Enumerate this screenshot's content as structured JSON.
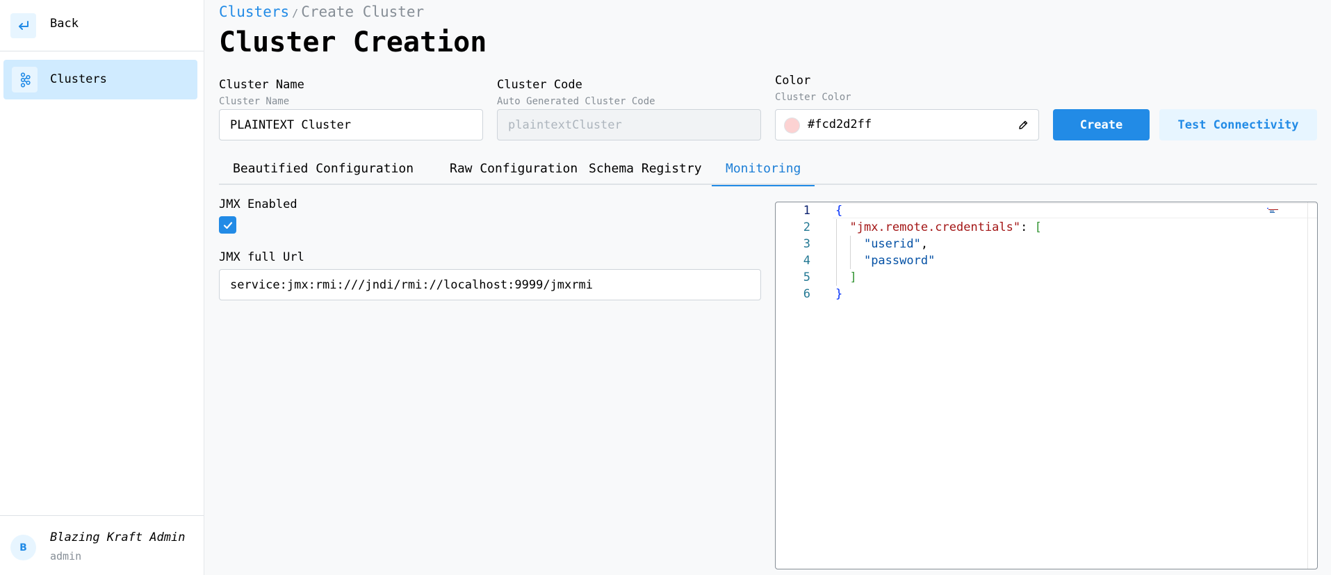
{
  "sidebar": {
    "back_label": "Back",
    "nav_items": [
      {
        "label": "Clusters",
        "icon": "kafka-icon",
        "active": true
      }
    ],
    "user": {
      "initial": "B",
      "name": "Blazing Kraft Admin",
      "role": "admin"
    }
  },
  "breadcrumb": {
    "link": "Clusters",
    "separator": "/",
    "current": "Create Cluster"
  },
  "page_title": "Cluster Creation",
  "form": {
    "cluster_name": {
      "label": "Cluster Name",
      "description": "Cluster Name",
      "value": "PLAINTEXT Cluster"
    },
    "cluster_code": {
      "label": "Cluster Code",
      "description": "Auto Generated Cluster Code",
      "placeholder": "plaintextCluster"
    },
    "color": {
      "label": "Color",
      "description": "Cluster Color",
      "value": "#fcd2d2ff",
      "swatch": "#fcd2d2"
    }
  },
  "buttons": {
    "create": "Create",
    "test_connectivity": "Test Connectivity"
  },
  "tabs": [
    {
      "label": "Beautified Configuration",
      "active": false
    },
    {
      "label": "Raw Configuration",
      "active": false
    },
    {
      "label": "Schema Registry",
      "active": false
    },
    {
      "label": "Monitoring",
      "active": true
    }
  ],
  "monitoring": {
    "jmx_enabled_label": "JMX Enabled",
    "jmx_enabled": true,
    "jmx_url_label": "JMX full Url",
    "jmx_url_value": "service:jmx:rmi:///jndi/rmi://localhost:9999/jmxrmi"
  },
  "editor": {
    "line_numbers": [
      "1",
      "2",
      "3",
      "4",
      "5",
      "6"
    ],
    "lines": [
      "{",
      "  \"jmx.remote.credentials\": [",
      "    \"userid\",",
      "    \"password\"",
      "  ]",
      "}"
    ]
  },
  "colors": {
    "accent": "#228be6",
    "accent_light": "#e7f5ff",
    "nav_active": "#d0ebff"
  }
}
